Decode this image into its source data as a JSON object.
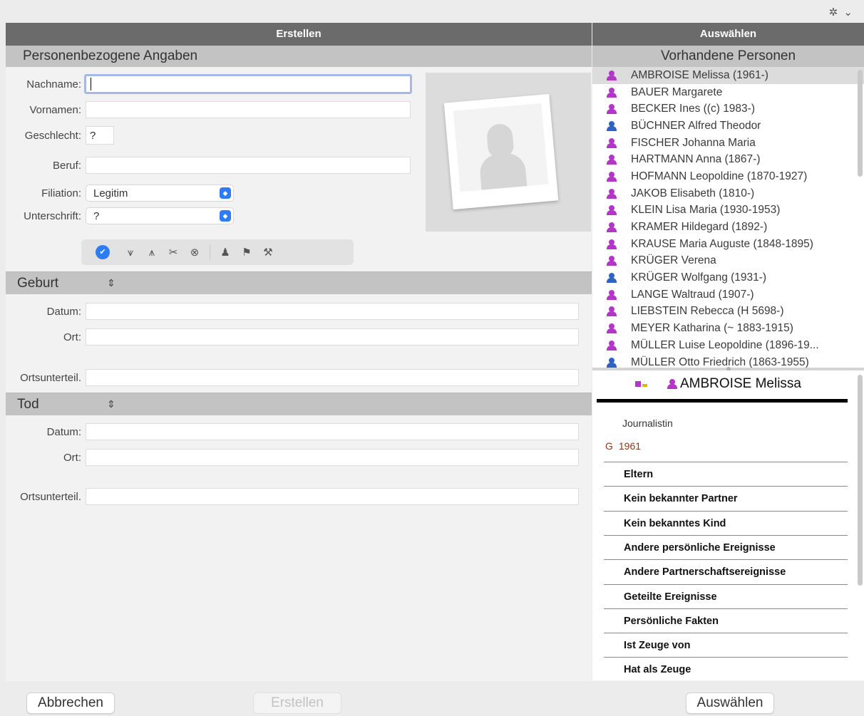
{
  "toolbar": {
    "gear_glyph": "✲",
    "chevron_glyph": "⌄"
  },
  "left": {
    "header": "Erstellen",
    "personal_section": "Personenbezogene Angaben",
    "fields": {
      "nachname_label": "Nachname:",
      "nachname_value": "",
      "vornamen_label": "Vornamen:",
      "vornamen_value": "",
      "geschlecht_label": "Geschlecht:",
      "geschlecht_value": "?",
      "beruf_label": "Beruf:",
      "beruf_value": "",
      "filiation_label": "Filiation:",
      "filiation_value": "Legitim",
      "unterschrift_label": "Unterschrift:",
      "unterschrift_value": "?"
    },
    "birth": {
      "title": "Geburt",
      "datum_label": "Datum:",
      "ort_label": "Ort:",
      "ortsunterteil_label": "Ortsunterteil."
    },
    "death": {
      "title": "Tod",
      "datum_label": "Datum:",
      "ort_label": "Ort:",
      "ortsunterteil_label": "Ortsunterteil."
    }
  },
  "right": {
    "header": "Auswählen",
    "list_title": "Vorhandene Personen",
    "persons": [
      {
        "name": "AMBROISE Melissa (1961-)",
        "sex": "f",
        "selected": true
      },
      {
        "name": "BAUER Margarete",
        "sex": "f"
      },
      {
        "name": "BECKER Ines ((c) 1983-)",
        "sex": "f"
      },
      {
        "name": "BÜCHNER Alfred Theodor",
        "sex": "m"
      },
      {
        "name": "FISCHER Johanna Maria",
        "sex": "f"
      },
      {
        "name": "HARTMANN Anna (1867-)",
        "sex": "f"
      },
      {
        "name": "HOFMANN Leopoldine (1870-1927)",
        "sex": "f"
      },
      {
        "name": "JAKOB Elisabeth (1810-)",
        "sex": "f"
      },
      {
        "name": "KLEIN Lisa Maria (1930-1953)",
        "sex": "f"
      },
      {
        "name": "KRAMER Hildegard (1892-)",
        "sex": "f"
      },
      {
        "name": "KRAUSE Maria Auguste (1848-1895)",
        "sex": "f"
      },
      {
        "name": "KRÜGER Verena",
        "sex": "f"
      },
      {
        "name": "KRÜGER Wolfgang (1931-)",
        "sex": "m"
      },
      {
        "name": "LANGE Waltraud (1907-)",
        "sex": "f"
      },
      {
        "name": "LIEBSTEIN Rebecca (H 5698-)",
        "sex": "f"
      },
      {
        "name": "MEYER Katharina (~ 1883-1915)",
        "sex": "f"
      },
      {
        "name": "MÜLLER Luise Leopoldine (1896-19...",
        "sex": "f"
      },
      {
        "name": "MÜLLER Otto Friedrich (1863-1955)",
        "sex": "m"
      }
    ],
    "detail": {
      "name": "AMBROISE Melissa",
      "occupation": "Journalistin",
      "birth_marker": "G",
      "birth_year": "1961",
      "sections": [
        "Eltern",
        "Kein bekannter Partner",
        "Kein bekanntes Kind",
        "Andere persönliche Ereignisse",
        "Andere Partnerschaftsereignisse",
        "Geteilte Ereignisse",
        "Persönliche Fakten",
        "Ist Zeuge von",
        "Hat als Zeuge"
      ]
    }
  },
  "buttons": {
    "cancel": "Abbrechen",
    "create": "Erstellen",
    "select": "Auswählen"
  }
}
